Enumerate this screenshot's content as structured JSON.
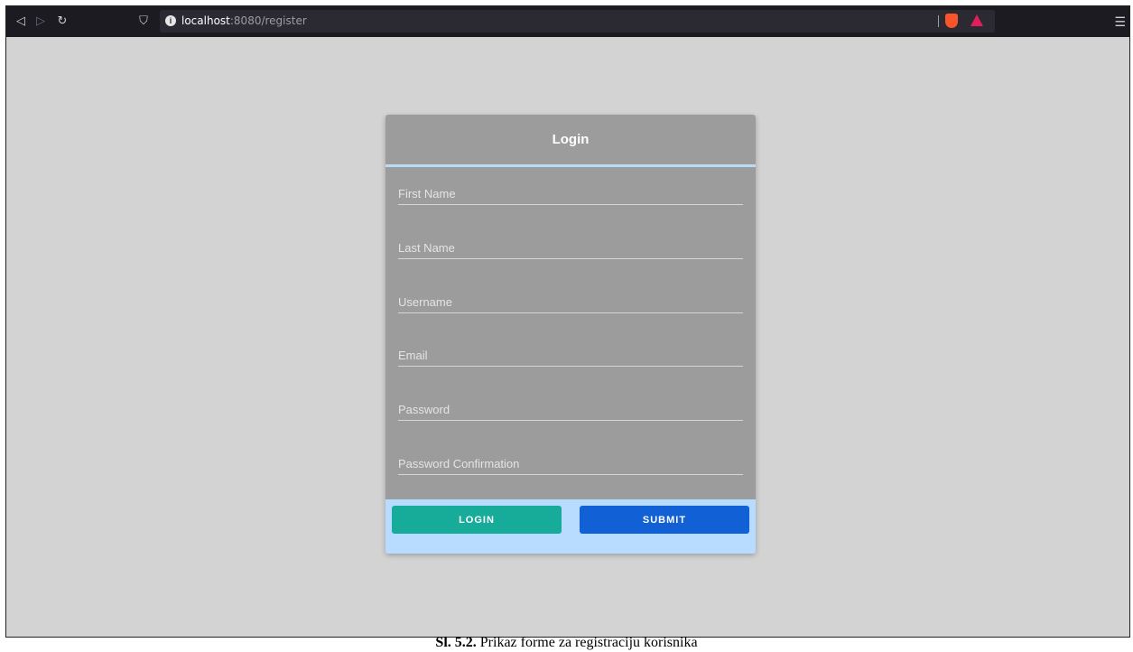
{
  "browser": {
    "url_host": "localhost",
    "url_rest": ":8080/register",
    "menu_icon": "hamburger-menu-icon"
  },
  "form": {
    "title": "Login",
    "fields": [
      {
        "placeholder": "First Name"
      },
      {
        "placeholder": "Last Name"
      },
      {
        "placeholder": "Username"
      },
      {
        "placeholder": "Email"
      },
      {
        "placeholder": "Password"
      },
      {
        "placeholder": "Password Confirmation"
      }
    ],
    "login_label": "LOGIN",
    "submit_label": "SUBMIT"
  },
  "colors": {
    "page_bg": "#d3d3d3",
    "card_bg": "#9c9c9c",
    "accent": "#b7dcf5",
    "footer_bg": "#b8dcff",
    "login_button": "#17ab9a",
    "submit_button": "#1160d6"
  },
  "caption": {
    "label": "Sl. 5.2.",
    "text": " Prikaz forme za registraciju korisnika"
  }
}
